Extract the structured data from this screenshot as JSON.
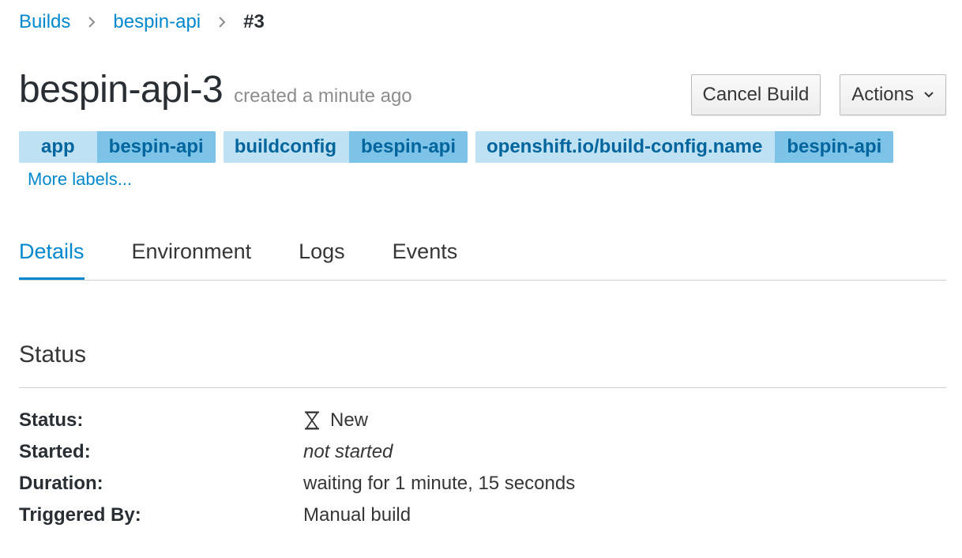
{
  "breadcrumb": {
    "builds": "Builds",
    "config": "bespin-api",
    "current": "#3"
  },
  "header": {
    "title": "bespin-api-3",
    "subtitle": "created a minute ago",
    "cancel_label": "Cancel Build",
    "actions_label": "Actions"
  },
  "labels": [
    {
      "key": "app",
      "value": "bespin-api"
    },
    {
      "key": "buildconfig",
      "value": "bespin-api"
    },
    {
      "key": "openshift.io/build-config.name",
      "value": "bespin-api"
    }
  ],
  "more_labels": "More labels...",
  "tabs": [
    {
      "label": "Details",
      "active": true
    },
    {
      "label": "Environment"
    },
    {
      "label": "Logs"
    },
    {
      "label": "Events"
    }
  ],
  "status_section": {
    "title": "Status",
    "rows": [
      {
        "term": "Status:",
        "value": "New",
        "icon": "hourglass-icon"
      },
      {
        "term": "Started:",
        "value": "not started"
      },
      {
        "term": "Duration:",
        "value": "waiting for 1 minute, 15 seconds"
      },
      {
        "term": "Triggered By:",
        "value": "Manual build"
      }
    ]
  },
  "colors": {
    "link": "#0088ce",
    "label_key_bg": "#bee1f4",
    "label_value_bg": "#7dc3e8",
    "label_text": "#00659c"
  }
}
